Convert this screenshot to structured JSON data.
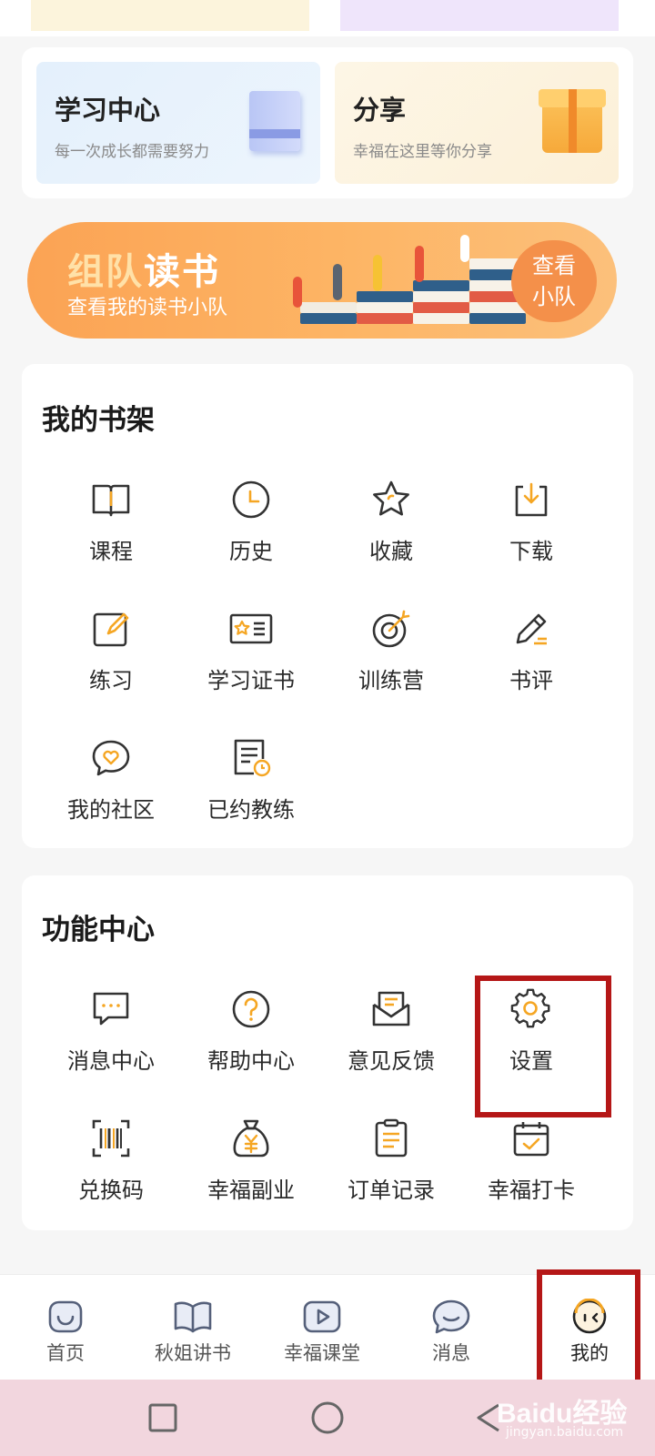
{
  "promos": {
    "study": {
      "title": "学习中心",
      "subtitle": "每一次成长都需要努力"
    },
    "share": {
      "title": "分享",
      "subtitle": "幸福在这里等你分享"
    }
  },
  "banner": {
    "title_accent": "组队",
    "title_rest": "读书",
    "subtitle": "查看我的读书小队",
    "button_line1": "查看",
    "button_line2": "小队"
  },
  "bookshelf": {
    "title": "我的书架",
    "items": [
      {
        "label": "课程",
        "icon": "open-book-icon"
      },
      {
        "label": "历史",
        "icon": "clock-icon"
      },
      {
        "label": "收藏",
        "icon": "star-icon"
      },
      {
        "label": "下载",
        "icon": "download-icon"
      },
      {
        "label": "练习",
        "icon": "edit-icon"
      },
      {
        "label": "学习证书",
        "icon": "certificate-icon"
      },
      {
        "label": "训练营",
        "icon": "target-icon"
      },
      {
        "label": "书评",
        "icon": "pen-icon"
      },
      {
        "label": "我的社区",
        "icon": "heart-chat-icon"
      },
      {
        "label": "已约教练",
        "icon": "schedule-doc-icon"
      }
    ]
  },
  "functions": {
    "title": "功能中心",
    "items": [
      {
        "label": "消息中心",
        "icon": "message-icon"
      },
      {
        "label": "帮助中心",
        "icon": "help-icon"
      },
      {
        "label": "意见反馈",
        "icon": "mail-icon"
      },
      {
        "label": "设置",
        "icon": "gear-icon"
      },
      {
        "label": "兑换码",
        "icon": "barcode-icon"
      },
      {
        "label": "幸福副业",
        "icon": "money-bag-icon"
      },
      {
        "label": "订单记录",
        "icon": "clipboard-icon"
      },
      {
        "label": "幸福打卡",
        "icon": "calendar-check-icon"
      }
    ]
  },
  "tabbar": {
    "items": [
      {
        "label": "首页",
        "icon": "home-icon"
      },
      {
        "label": "秋姐讲书",
        "icon": "book-icon"
      },
      {
        "label": "幸福课堂",
        "icon": "play-icon"
      },
      {
        "label": "消息",
        "icon": "chat-icon"
      },
      {
        "label": "我的",
        "icon": "profile-icon"
      }
    ],
    "active_index": 4
  },
  "watermark": {
    "brand": "Baidu经验",
    "url": "jingyan.baidu.com"
  },
  "colors": {
    "accent": "#f5a623",
    "highlight": "#b51717",
    "banner": "#fba354"
  }
}
